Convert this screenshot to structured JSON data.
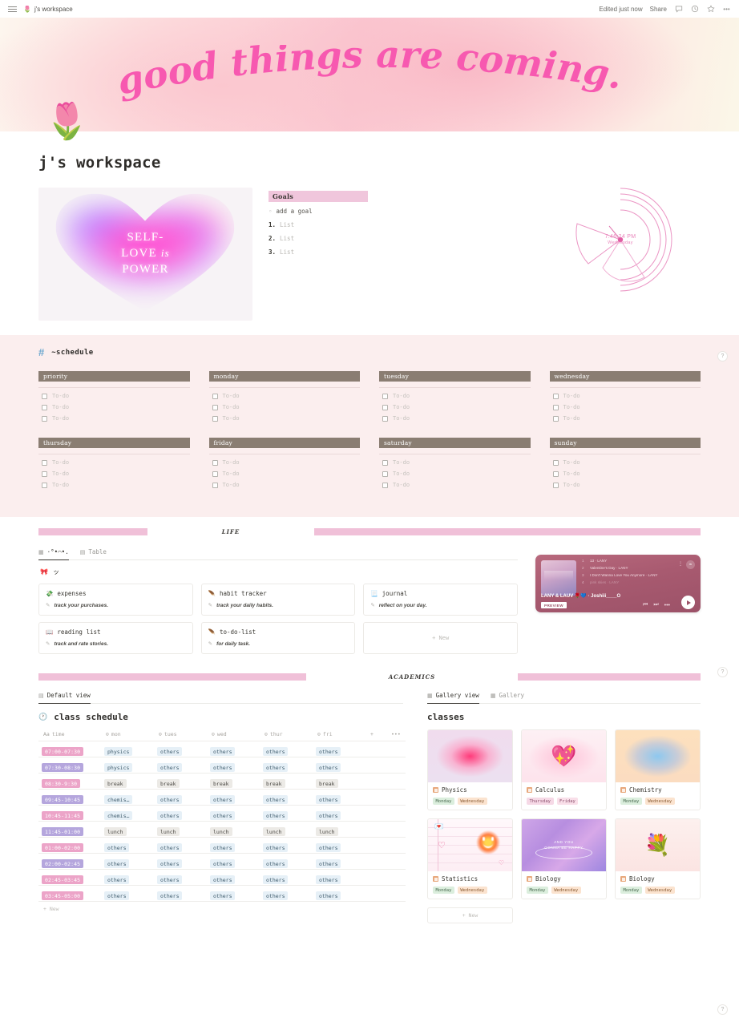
{
  "topbar": {
    "breadcrumb": "j's workspace",
    "breadcrumb_icon": "🌷",
    "edited": "Edited just now",
    "share": "Share",
    "icons": [
      "comment-icon",
      "clock-icon",
      "star-icon",
      "more-icon"
    ]
  },
  "banner": {
    "text": "good things are coming."
  },
  "page": {
    "icon": "🌷",
    "title": "j's workspace"
  },
  "hero": {
    "image_caption_line1": "SELF-",
    "image_caption_line2": "LOVE",
    "image_caption_italic": "is",
    "image_caption_line3": "POWER"
  },
  "goals": {
    "title": "Goals",
    "add_label": "add a goal",
    "items": [
      {
        "num": "1.",
        "text": "List"
      },
      {
        "num": "2.",
        "text": "List"
      },
      {
        "num": "3.",
        "text": "List"
      }
    ]
  },
  "clock": {
    "time": "7:46:24 PM",
    "day": "Wednesday",
    "color": "#e985bb"
  },
  "schedule": {
    "heading": "~schedule",
    "hash": "#",
    "todo_label": "To-do",
    "columns": [
      {
        "label": "priority",
        "todos": [
          "To-do",
          "To-do",
          "To-do"
        ]
      },
      {
        "label": "monday",
        "todos": [
          "To-do",
          "To-do",
          "To-do"
        ]
      },
      {
        "label": "tuesday",
        "todos": [
          "To-do",
          "To-do",
          "To-do"
        ]
      },
      {
        "label": "wednesday",
        "todos": [
          "To-do",
          "To-do",
          "To-do"
        ]
      },
      {
        "label": "thursday",
        "todos": [
          "To-do",
          "To-do",
          "To-do"
        ]
      },
      {
        "label": "friday",
        "todos": [
          "To-do",
          "To-do",
          "To-do"
        ]
      },
      {
        "label": "saturday",
        "todos": [
          "To-do",
          "To-do",
          "To-do"
        ]
      },
      {
        "label": "sunday",
        "todos": [
          "To-do",
          "To-do",
          "To-do"
        ]
      }
    ]
  },
  "dividers": {
    "life": "LIFE",
    "academics": "ACADEMICS",
    "bar_color": "#f0c0d8"
  },
  "life_db": {
    "tabs": [
      {
        "label": "·°•⌒•.",
        "icon": "gallery-icon",
        "active": true
      },
      {
        "label": "Table",
        "icon": "table-icon",
        "active": false
      }
    ],
    "db_name": "ッ",
    "db_icon": "🎀",
    "new_label": "+ New",
    "cards": [
      {
        "icon": "💸",
        "title": "expenses",
        "subtitle": "track your purchases."
      },
      {
        "icon": "🪶",
        "title": "habit tracker",
        "subtitle": "track your daily habits."
      },
      {
        "icon": "📃",
        "title": "journal",
        "subtitle": "reflect on your day."
      },
      {
        "icon": "📖",
        "title": "reading list",
        "subtitle": "track and rate stories."
      },
      {
        "icon": "🪶",
        "title": "to-do-list",
        "subtitle": "for daily task."
      }
    ]
  },
  "player": {
    "now_playing": "LANY & LAUV 🌹💙 · Joshiii____O",
    "badge": "PREVIEW",
    "tracks": [
      {
        "n": "1",
        "title": "13 · LANY"
      },
      {
        "n": "2",
        "title": "Valentine's Day · LANY"
      },
      {
        "n": "3",
        "title": "I Don't Wanna Love You Anymore · LANY"
      },
      {
        "n": "4",
        "title": "pink skies · LANY"
      }
    ],
    "controls": [
      "prev-icon",
      "next-icon",
      "more-icon",
      "play-icon"
    ]
  },
  "class_schedule": {
    "view_tab": "Default view",
    "view_icon": "table-icon",
    "title": "class schedule",
    "title_icon": "🕐",
    "new_label": "+ New",
    "columns": [
      "time",
      "mon",
      "tues",
      "wed",
      "thur",
      "fri"
    ],
    "column_icons": [
      "Aa",
      "select-icon",
      "select-icon",
      "select-icon",
      "select-icon",
      "select-icon"
    ],
    "rows": [
      {
        "time": "07:00-07:30",
        "time_color": "#eca4c8",
        "cells": [
          "physics",
          "others",
          "others",
          "others",
          "others"
        ]
      },
      {
        "time": "07:30-08:30",
        "time_color": "#b5a6dd",
        "cells": [
          "physics",
          "others",
          "others",
          "others",
          "others"
        ]
      },
      {
        "time": "08:30-9:30",
        "time_color": "#eca4c8",
        "cells": [
          "break",
          "break",
          "break",
          "break",
          "break"
        ]
      },
      {
        "time": "09:45-10:45",
        "time_color": "#b5a6dd",
        "cells": [
          "chemis…",
          "others",
          "others",
          "others",
          "others"
        ]
      },
      {
        "time": "10:45-11:45",
        "time_color": "#eca4c8",
        "cells": [
          "chemis…",
          "others",
          "others",
          "others",
          "others"
        ]
      },
      {
        "time": "11:45-01:00",
        "time_color": "#b5a6dd",
        "cells": [
          "lunch",
          "lunch",
          "lunch",
          "lunch",
          "lunch"
        ]
      },
      {
        "time": "01:00-02:00",
        "time_color": "#eca4c8",
        "cells": [
          "others",
          "others",
          "others",
          "others",
          "others"
        ]
      },
      {
        "time": "02:00-02:45",
        "time_color": "#b5a6dd",
        "cells": [
          "others",
          "others",
          "others",
          "others",
          "others"
        ]
      },
      {
        "time": "02:45-03:45",
        "time_color": "#eca4c8",
        "cells": [
          "others",
          "others",
          "others",
          "others",
          "others"
        ]
      },
      {
        "time": "03:45-05:00",
        "time_color": "#eca4c8",
        "cells": [
          "others",
          "others",
          "others",
          "others",
          "others"
        ]
      }
    ]
  },
  "classes_db": {
    "tabs": [
      {
        "label": "Gallery view",
        "active": true
      },
      {
        "label": "Gallery",
        "active": false
      }
    ],
    "title": "classes",
    "new_label": "+ New",
    "cards": [
      {
        "name": "Physics",
        "tags": [
          "Monday",
          "Wednesday"
        ],
        "cover": "pink-radial"
      },
      {
        "name": "Calculus",
        "tags": [
          "Thursday",
          "Friday"
        ],
        "cover": "winged-heart"
      },
      {
        "name": "Chemistry",
        "tags": [
          "Monday",
          "Wednesday"
        ],
        "cover": "blue-orange-radial"
      },
      {
        "name": "Statistics",
        "tags": [
          "Monday",
          "Wednesday"
        ],
        "cover": "smiley-notebook"
      },
      {
        "name": "Biology",
        "tags": [
          "Monday",
          "Wednesday"
        ],
        "cover": "purple-happy",
        "cover_text_1": "AND YOU",
        "cover_text_2": "GONNA BE HAPPY"
      },
      {
        "name": "Biology",
        "tags": [
          "Monday",
          "Wednesday"
        ],
        "cover": "tulip-bouquet"
      }
    ]
  },
  "help_buttons": [
    "?",
    "?",
    "?"
  ]
}
